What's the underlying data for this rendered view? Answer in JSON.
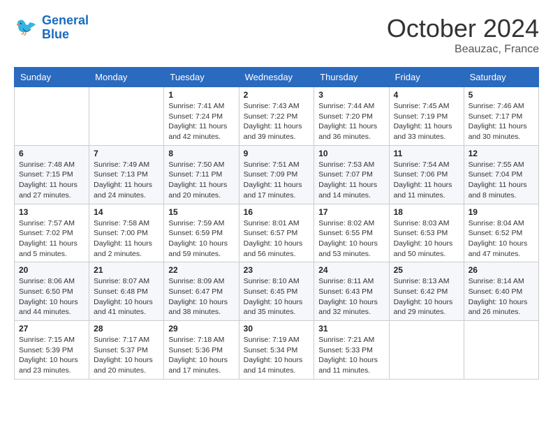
{
  "header": {
    "logo_line1": "General",
    "logo_line2": "Blue",
    "month": "October 2024",
    "location": "Beauzac, France"
  },
  "weekdays": [
    "Sunday",
    "Monday",
    "Tuesday",
    "Wednesday",
    "Thursday",
    "Friday",
    "Saturday"
  ],
  "weeks": [
    [
      {
        "day": "",
        "info": ""
      },
      {
        "day": "",
        "info": ""
      },
      {
        "day": "1",
        "info": "Sunrise: 7:41 AM\nSunset: 7:24 PM\nDaylight: 11 hours and 42 minutes."
      },
      {
        "day": "2",
        "info": "Sunrise: 7:43 AM\nSunset: 7:22 PM\nDaylight: 11 hours and 39 minutes."
      },
      {
        "day": "3",
        "info": "Sunrise: 7:44 AM\nSunset: 7:20 PM\nDaylight: 11 hours and 36 minutes."
      },
      {
        "day": "4",
        "info": "Sunrise: 7:45 AM\nSunset: 7:19 PM\nDaylight: 11 hours and 33 minutes."
      },
      {
        "day": "5",
        "info": "Sunrise: 7:46 AM\nSunset: 7:17 PM\nDaylight: 11 hours and 30 minutes."
      }
    ],
    [
      {
        "day": "6",
        "info": "Sunrise: 7:48 AM\nSunset: 7:15 PM\nDaylight: 11 hours and 27 minutes."
      },
      {
        "day": "7",
        "info": "Sunrise: 7:49 AM\nSunset: 7:13 PM\nDaylight: 11 hours and 24 minutes."
      },
      {
        "day": "8",
        "info": "Sunrise: 7:50 AM\nSunset: 7:11 PM\nDaylight: 11 hours and 20 minutes."
      },
      {
        "day": "9",
        "info": "Sunrise: 7:51 AM\nSunset: 7:09 PM\nDaylight: 11 hours and 17 minutes."
      },
      {
        "day": "10",
        "info": "Sunrise: 7:53 AM\nSunset: 7:07 PM\nDaylight: 11 hours and 14 minutes."
      },
      {
        "day": "11",
        "info": "Sunrise: 7:54 AM\nSunset: 7:06 PM\nDaylight: 11 hours and 11 minutes."
      },
      {
        "day": "12",
        "info": "Sunrise: 7:55 AM\nSunset: 7:04 PM\nDaylight: 11 hours and 8 minutes."
      }
    ],
    [
      {
        "day": "13",
        "info": "Sunrise: 7:57 AM\nSunset: 7:02 PM\nDaylight: 11 hours and 5 minutes."
      },
      {
        "day": "14",
        "info": "Sunrise: 7:58 AM\nSunset: 7:00 PM\nDaylight: 11 hours and 2 minutes."
      },
      {
        "day": "15",
        "info": "Sunrise: 7:59 AM\nSunset: 6:59 PM\nDaylight: 10 hours and 59 minutes."
      },
      {
        "day": "16",
        "info": "Sunrise: 8:01 AM\nSunset: 6:57 PM\nDaylight: 10 hours and 56 minutes."
      },
      {
        "day": "17",
        "info": "Sunrise: 8:02 AM\nSunset: 6:55 PM\nDaylight: 10 hours and 53 minutes."
      },
      {
        "day": "18",
        "info": "Sunrise: 8:03 AM\nSunset: 6:53 PM\nDaylight: 10 hours and 50 minutes."
      },
      {
        "day": "19",
        "info": "Sunrise: 8:04 AM\nSunset: 6:52 PM\nDaylight: 10 hours and 47 minutes."
      }
    ],
    [
      {
        "day": "20",
        "info": "Sunrise: 8:06 AM\nSunset: 6:50 PM\nDaylight: 10 hours and 44 minutes."
      },
      {
        "day": "21",
        "info": "Sunrise: 8:07 AM\nSunset: 6:48 PM\nDaylight: 10 hours and 41 minutes."
      },
      {
        "day": "22",
        "info": "Sunrise: 8:09 AM\nSunset: 6:47 PM\nDaylight: 10 hours and 38 minutes."
      },
      {
        "day": "23",
        "info": "Sunrise: 8:10 AM\nSunset: 6:45 PM\nDaylight: 10 hours and 35 minutes."
      },
      {
        "day": "24",
        "info": "Sunrise: 8:11 AM\nSunset: 6:43 PM\nDaylight: 10 hours and 32 minutes."
      },
      {
        "day": "25",
        "info": "Sunrise: 8:13 AM\nSunset: 6:42 PM\nDaylight: 10 hours and 29 minutes."
      },
      {
        "day": "26",
        "info": "Sunrise: 8:14 AM\nSunset: 6:40 PM\nDaylight: 10 hours and 26 minutes."
      }
    ],
    [
      {
        "day": "27",
        "info": "Sunrise: 7:15 AM\nSunset: 5:39 PM\nDaylight: 10 hours and 23 minutes."
      },
      {
        "day": "28",
        "info": "Sunrise: 7:17 AM\nSunset: 5:37 PM\nDaylight: 10 hours and 20 minutes."
      },
      {
        "day": "29",
        "info": "Sunrise: 7:18 AM\nSunset: 5:36 PM\nDaylight: 10 hours and 17 minutes."
      },
      {
        "day": "30",
        "info": "Sunrise: 7:19 AM\nSunset: 5:34 PM\nDaylight: 10 hours and 14 minutes."
      },
      {
        "day": "31",
        "info": "Sunrise: 7:21 AM\nSunset: 5:33 PM\nDaylight: 10 hours and 11 minutes."
      },
      {
        "day": "",
        "info": ""
      },
      {
        "day": "",
        "info": ""
      }
    ]
  ]
}
